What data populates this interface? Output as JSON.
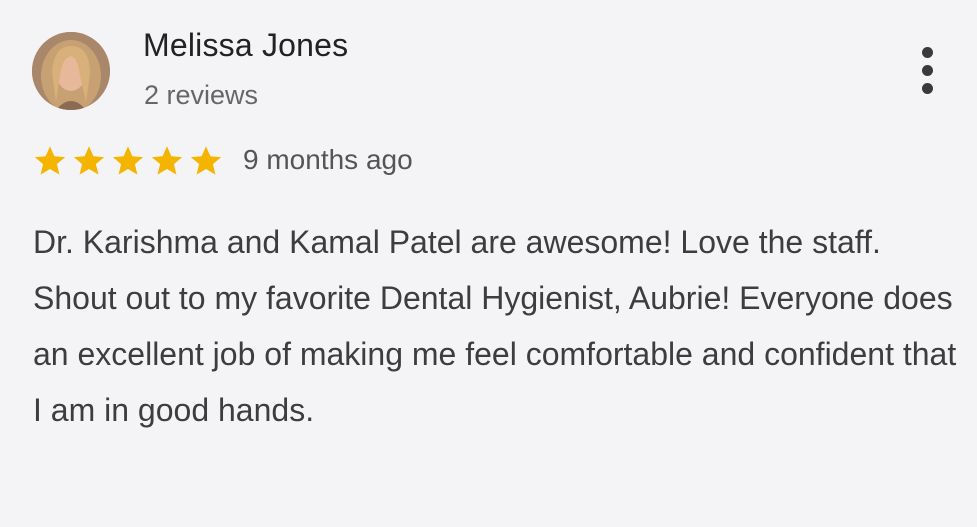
{
  "reviewer": {
    "name": "Melissa Jones",
    "reviews_count": "2 reviews"
  },
  "rating": {
    "stars": 5,
    "max": 5,
    "color": "#f4b400"
  },
  "time_ago": "9 months ago",
  "review_text": "Dr. Karishma and Kamal Patel are awesome! Love the staff. Shout out to my favorite Dental Hygienist, Aubrie! Everyone does an excellent job of making me feel comfortable and confident that I am in good hands.",
  "icons": {
    "more": "more-vert-icon",
    "star": "star-icon"
  }
}
